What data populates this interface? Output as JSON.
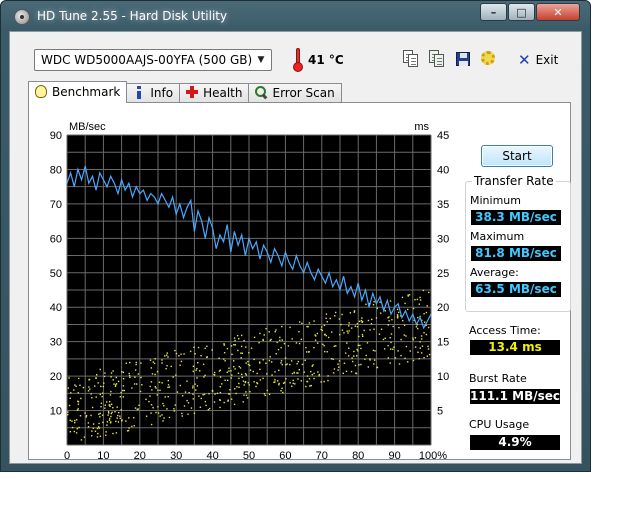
{
  "window": {
    "title": "HD Tune 2.55 - Hard Disk Utility",
    "buttons": {
      "minimize": "–",
      "maximize": "□",
      "close": "✕"
    }
  },
  "toolbar": {
    "drive": "WDC WD5000AAJS-00YFA (500 GB)",
    "temperature": "41 °C",
    "exit_label": "Exit"
  },
  "tabs": [
    {
      "label": "Benchmark",
      "active": true
    },
    {
      "label": "Info",
      "active": false
    },
    {
      "label": "Health",
      "active": false
    },
    {
      "label": "Error Scan",
      "active": false
    }
  ],
  "benchmark": {
    "start_label": "Start",
    "transfer_rate": {
      "title": "Transfer Rate",
      "minimum_label": "Minimum",
      "minimum": "38.3 MB/sec",
      "maximum_label": "Maximum",
      "maximum": "81.8 MB/sec",
      "average_label": "Average:",
      "average": "63.5 MB/sec"
    },
    "access_time_label": "Access Time:",
    "access_time": "13.4 ms",
    "burst_rate_label": "Burst Rate",
    "burst_rate": "111.1 MB/sec",
    "cpu_usage_label": "CPU Usage",
    "cpu_usage": "4.9%"
  },
  "colors": {
    "transfer_line": "#4aa8ff",
    "access_dots": "#e8e840",
    "value_cyan": "#40c8ff",
    "value_yellow": "#f0f000",
    "graph_bg": "#000000",
    "grid": "#6a6a6a"
  },
  "chart_data": {
    "type": "line",
    "left_unit": "MB/sec",
    "right_unit": "ms",
    "x_ticks": [
      "0",
      "10",
      "20",
      "30",
      "40",
      "50",
      "60",
      "70",
      "80",
      "90",
      "100%"
    ],
    "left_ticks": [
      "10",
      "20",
      "30",
      "40",
      "50",
      "60",
      "70",
      "80",
      "90"
    ],
    "right_ticks": [
      "5",
      "10",
      "15",
      "20",
      "25",
      "30",
      "35",
      "40",
      "45"
    ],
    "xlim": [
      0,
      100
    ],
    "ylim_left": [
      0,
      90
    ],
    "ylim_right": [
      0,
      45
    ],
    "grid": true,
    "series": [
      {
        "axis": "left",
        "x": [
          0,
          1,
          2,
          3,
          4,
          5,
          6,
          7,
          8,
          9,
          10,
          11,
          12,
          13,
          14,
          15,
          16,
          17,
          18,
          19,
          20,
          21,
          22,
          23,
          24,
          25,
          26,
          27,
          28,
          29,
          30,
          31,
          32,
          33,
          34,
          35,
          36,
          37,
          38,
          39,
          40,
          41,
          42,
          43,
          44,
          45,
          46,
          47,
          48,
          49,
          50,
          51,
          52,
          53,
          54,
          55,
          56,
          57,
          58,
          59,
          60,
          61,
          62,
          63,
          64,
          65,
          66,
          67,
          68,
          69,
          70,
          71,
          72,
          73,
          74,
          75,
          76,
          77,
          78,
          79,
          80,
          81,
          82,
          83,
          84,
          85,
          86,
          87,
          88,
          89,
          90,
          91,
          92,
          93,
          94,
          95,
          96,
          97,
          98,
          99,
          100
        ],
        "values": [
          76,
          79,
          75,
          80,
          77,
          81,
          76,
          78,
          74,
          79,
          77,
          75,
          78,
          76,
          73,
          77,
          74,
          76,
          72,
          75,
          73,
          74,
          71,
          73,
          72,
          70,
          73,
          71,
          69,
          72,
          67,
          70,
          66,
          69,
          71,
          62,
          68,
          65,
          60,
          66,
          63,
          57,
          61,
          59,
          64,
          56,
          62,
          58,
          61,
          55,
          60,
          57,
          59,
          54,
          58,
          56,
          53,
          57,
          55,
          52,
          56,
          53,
          51,
          55,
          52,
          50,
          53,
          50,
          48,
          51,
          49,
          47,
          50,
          46,
          48,
          45,
          49,
          44,
          46,
          43,
          47,
          42,
          45,
          40,
          44,
          41,
          43,
          39,
          42,
          38,
          40,
          41,
          37,
          39,
          36,
          38,
          35,
          37,
          34,
          36,
          38
        ]
      }
    ]
  }
}
